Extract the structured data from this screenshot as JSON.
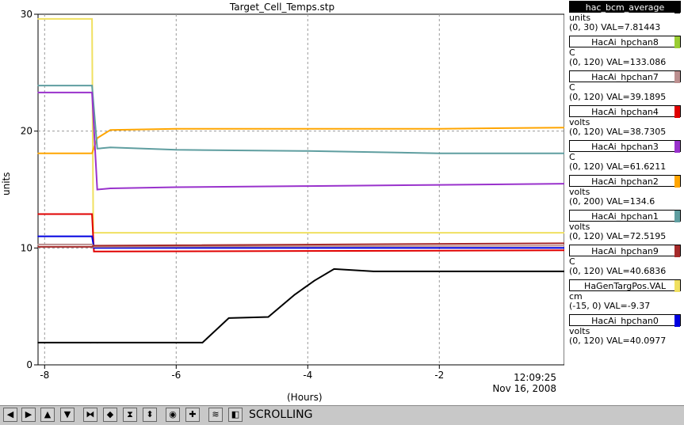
{
  "window": {
    "title": "Target_Cell_Temps.stp"
  },
  "axes": {
    "ylabel": "units",
    "xlabel": "(Hours)",
    "time_readout": "12:09:25",
    "date_readout": "Nov 16, 2008",
    "y_ticks": [
      "0",
      "10",
      "20",
      "30"
    ],
    "x_ticks": [
      "-8",
      "-6",
      "-4",
      "-2"
    ]
  },
  "colors": {
    "hac_bcm_average": "#000000",
    "hpchan8": "#9acd32",
    "hpchan7": "#bc8f8f",
    "hpchan4": "#e00000",
    "hpchan3": "#9932cc",
    "hpchan2": "#ffa500",
    "hpchan1": "#5f9ea0",
    "hpchan9": "#a52a2a",
    "targpos": "#f0e060",
    "hpchan0": "#0000e0"
  },
  "legend": [
    {
      "name": "hac_bcm_average",
      "unit": "units",
      "range": "(0, 30) VAL=7.81443",
      "color": "#000000",
      "inverted": true
    },
    {
      "name": "HacAi_hpchan8",
      "unit": "C",
      "range": "(0, 120) VAL=133.086",
      "color": "#9acd32"
    },
    {
      "name": "HacAi_hpchan7",
      "unit": "C",
      "range": "(0, 120) VAL=39.1895",
      "color": "#bc8f8f"
    },
    {
      "name": "HacAi_hpchan4",
      "unit": "volts",
      "range": "(0, 120) VAL=38.7305",
      "color": "#e00000"
    },
    {
      "name": "HacAi_hpchan3",
      "unit": "C",
      "range": "(0, 120) VAL=61.6211",
      "color": "#9932cc"
    },
    {
      "name": "HacAi_hpchan2",
      "unit": "volts",
      "range": "(0, 200) VAL=134.6",
      "color": "#ffa500"
    },
    {
      "name": "HacAi_hpchan1",
      "unit": "volts",
      "range": "(0, 120) VAL=72.5195",
      "color": "#5f9ea0"
    },
    {
      "name": "HacAi_hpchan9",
      "unit": "C",
      "range": "(0, 120) VAL=40.6836",
      "color": "#a52a2a"
    },
    {
      "name": "HaGenTargPos.VAL",
      "unit": "cm",
      "range": "(-15, 0) VAL=-9.37",
      "color": "#f0e060"
    },
    {
      "name": "HacAi_hpchan0",
      "unit": "volts",
      "range": "(0, 120) VAL=40.0977",
      "color": "#0000e0"
    }
  ],
  "toolbar": {
    "status": "SCROLLING",
    "buttons": [
      "left-arrow-icon",
      "right-arrow-icon",
      "up-arrow-icon",
      "down-arrow-icon",
      "zoom-in-x-icon",
      "zoom-out-x-icon",
      "zoom-in-y-icon",
      "zoom-out-y-icon",
      "record-icon",
      "add-icon",
      "fit-icon",
      "back-icon"
    ]
  },
  "chart_data": {
    "type": "line",
    "title": "Target_Cell_Temps.stp",
    "xlabel": "(Hours)",
    "ylabel": "units",
    "xlim": [
      -8.1,
      -0.1
    ],
    "ylim": [
      0,
      30
    ],
    "grid": true,
    "legend_placement": "right",
    "series": [
      {
        "name": "HaGenTargPos.VAL",
        "color": "#f0e060",
        "x": [
          -8.1,
          -7.28,
          -7.26,
          -0.1
        ],
        "y": [
          29.6,
          29.6,
          11.3,
          11.3
        ]
      },
      {
        "name": "HacAi_hpchan2",
        "color": "#ffa500",
        "x": [
          -8.1,
          -7.28,
          -7.2,
          -7.0,
          -6.0,
          -4.0,
          -2.0,
          -0.1
        ],
        "y": [
          18.1,
          18.1,
          19.4,
          20.1,
          20.2,
          20.2,
          20.2,
          20.3
        ]
      },
      {
        "name": "HacAi_hpchan1",
        "color": "#5f9ea0",
        "x": [
          -8.1,
          -7.28,
          -7.2,
          -7.0,
          -6.0,
          -4.0,
          -2.0,
          -0.1
        ],
        "y": [
          23.9,
          23.9,
          18.5,
          18.6,
          18.4,
          18.3,
          18.1,
          18.1
        ]
      },
      {
        "name": "HacAi_hpchan3",
        "color": "#9932cc",
        "x": [
          -8.1,
          -7.28,
          -7.2,
          -7.0,
          -6.0,
          -4.0,
          -2.0,
          -0.1
        ],
        "y": [
          23.3,
          23.3,
          15.0,
          15.1,
          15.2,
          15.3,
          15.4,
          15.5
        ]
      },
      {
        "name": "HacAi_hpchan4",
        "color": "#e00000",
        "x": [
          -8.1,
          -7.28,
          -7.25,
          -0.1
        ],
        "y": [
          12.9,
          12.9,
          9.7,
          9.8
        ]
      },
      {
        "name": "HacAi_hpchan0",
        "color": "#0000e0",
        "x": [
          -8.1,
          -7.28,
          -7.25,
          -0.1
        ],
        "y": [
          11.0,
          11.0,
          10.0,
          10.0
        ]
      },
      {
        "name": "HacAi_hpchan7",
        "color": "#bc8f8f",
        "x": [
          -8.1,
          -7.28,
          -7.25,
          -0.1
        ],
        "y": [
          10.3,
          10.3,
          10.1,
          10.2
        ]
      },
      {
        "name": "HacAi_hpchan9",
        "color": "#a52a2a",
        "x": [
          -8.1,
          -7.28,
          -7.25,
          -0.1
        ],
        "y": [
          10.1,
          10.1,
          10.2,
          10.4
        ]
      },
      {
        "name": "hac_bcm_average",
        "color": "#000000",
        "x": [
          -8.1,
          -7.3,
          -7.2,
          -5.6,
          -5.2,
          -4.6,
          -4.2,
          -3.9,
          -3.6,
          -3.0,
          -2.0,
          -1.0,
          -0.1
        ],
        "y": [
          1.9,
          1.9,
          1.9,
          1.9,
          4.0,
          4.1,
          6.0,
          7.2,
          8.2,
          8.0,
          8.0,
          8.0,
          8.0
        ]
      }
    ]
  }
}
